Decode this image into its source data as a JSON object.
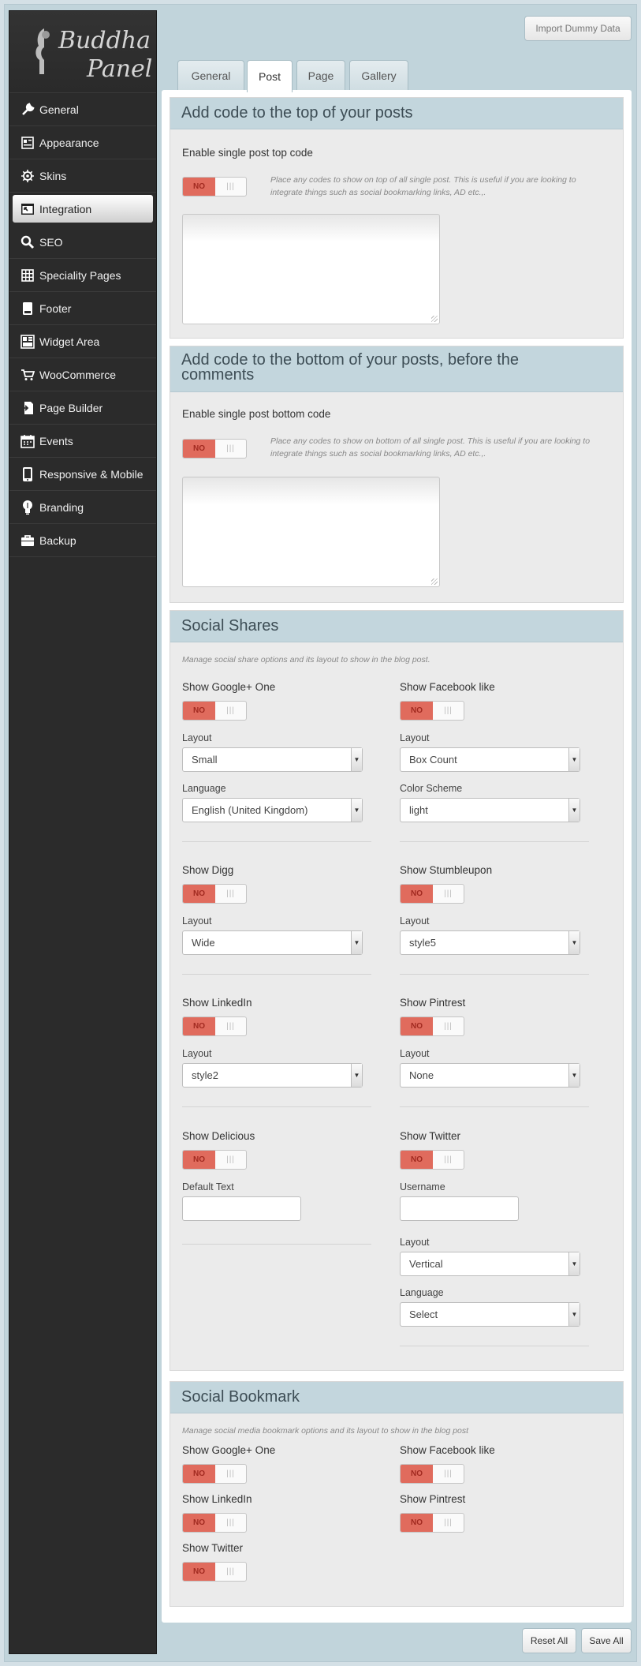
{
  "brand": {
    "line1": "Buddha",
    "line2": "Panel"
  },
  "sidebar": {
    "items": [
      {
        "label": "General",
        "icon": "wrench-icon"
      },
      {
        "label": "Appearance",
        "icon": "appearance-icon"
      },
      {
        "label": "Skins",
        "icon": "gear-icon"
      },
      {
        "label": "Integration",
        "icon": "integration-icon"
      },
      {
        "label": "SEO",
        "icon": "search-icon"
      },
      {
        "label": "Speciality Pages",
        "icon": "grid-icon"
      },
      {
        "label": "Footer",
        "icon": "footer-icon"
      },
      {
        "label": "Widget Area",
        "icon": "widget-icon"
      },
      {
        "label": "WooCommerce",
        "icon": "cart-icon"
      },
      {
        "label": "Page Builder",
        "icon": "page-builder-icon"
      },
      {
        "label": "Events",
        "icon": "calendar-icon"
      },
      {
        "label": "Responsive & Mobile",
        "icon": "mobile-icon"
      },
      {
        "label": "Branding",
        "icon": "bulb-icon"
      },
      {
        "label": "Backup",
        "icon": "briefcase-icon"
      }
    ],
    "active_index": 3
  },
  "header": {
    "import_label": "Import Dummy Data"
  },
  "tabs": [
    "General",
    "Post",
    "Page",
    "Gallery"
  ],
  "active_tab": "Post",
  "toggle": {
    "off_label": "NO",
    "grip": "|||"
  },
  "top_code": {
    "title": "Add code to the top of your posts",
    "enable_label": "Enable single post top code",
    "hint_line1": "Place any codes to show on top of all single post. This is useful if you are looking to",
    "hint_line2": "integrate things such as social bookmarking links, AD etc.,."
  },
  "bottom_code": {
    "title_line1": "Add code to the bottom of your posts, before the",
    "title_line2": "comments",
    "enable_label": "Enable single post bottom code",
    "hint_line1": "Place any codes to show on bottom of all single post. This is useful if you are looking to",
    "hint_line2": "integrate things such as social bookmarking links, AD etc.,."
  },
  "social_shares": {
    "title": "Social Shares",
    "desc": "Manage social share options and its layout to show in the blog post.",
    "google": {
      "label": "Show Google+ One",
      "layout_label": "Layout",
      "layout_value": "Small",
      "language_label": "Language",
      "language_value": "English (United Kingdom)"
    },
    "facebook": {
      "label": "Show Facebook like",
      "layout_label": "Layout",
      "layout_value": "Box Count",
      "color_label": "Color Scheme",
      "color_value": "light"
    },
    "digg": {
      "label": "Show Digg",
      "layout_label": "Layout",
      "layout_value": "Wide"
    },
    "stumble": {
      "label": "Show Stumbleupon",
      "layout_label": "Layout",
      "layout_value": "style5"
    },
    "linkedin": {
      "label": "Show LinkedIn",
      "layout_label": "Layout",
      "layout_value": "style2"
    },
    "pintrest": {
      "label": "Show Pintrest",
      "layout_label": "Layout",
      "layout_value": "None"
    },
    "delicious": {
      "label": "Show Delicious",
      "text_label": "Default Text"
    },
    "twitter": {
      "label": "Show Twitter",
      "username_label": "Username",
      "layout_label": "Layout",
      "layout_value": "Vertical",
      "language_label": "Language",
      "language_value": "Select"
    }
  },
  "social_bookmark": {
    "title": "Social Bookmark",
    "desc": "Manage social media bookmark options and its layout to show in the blog post",
    "google_label": "Show Google+ One",
    "facebook_label": "Show Facebook like",
    "linkedin_label": "Show LinkedIn",
    "pintrest_label": "Show Pintrest",
    "twitter_label": "Show Twitter"
  },
  "footer": {
    "reset_label": "Reset All",
    "save_label": "Save All"
  }
}
